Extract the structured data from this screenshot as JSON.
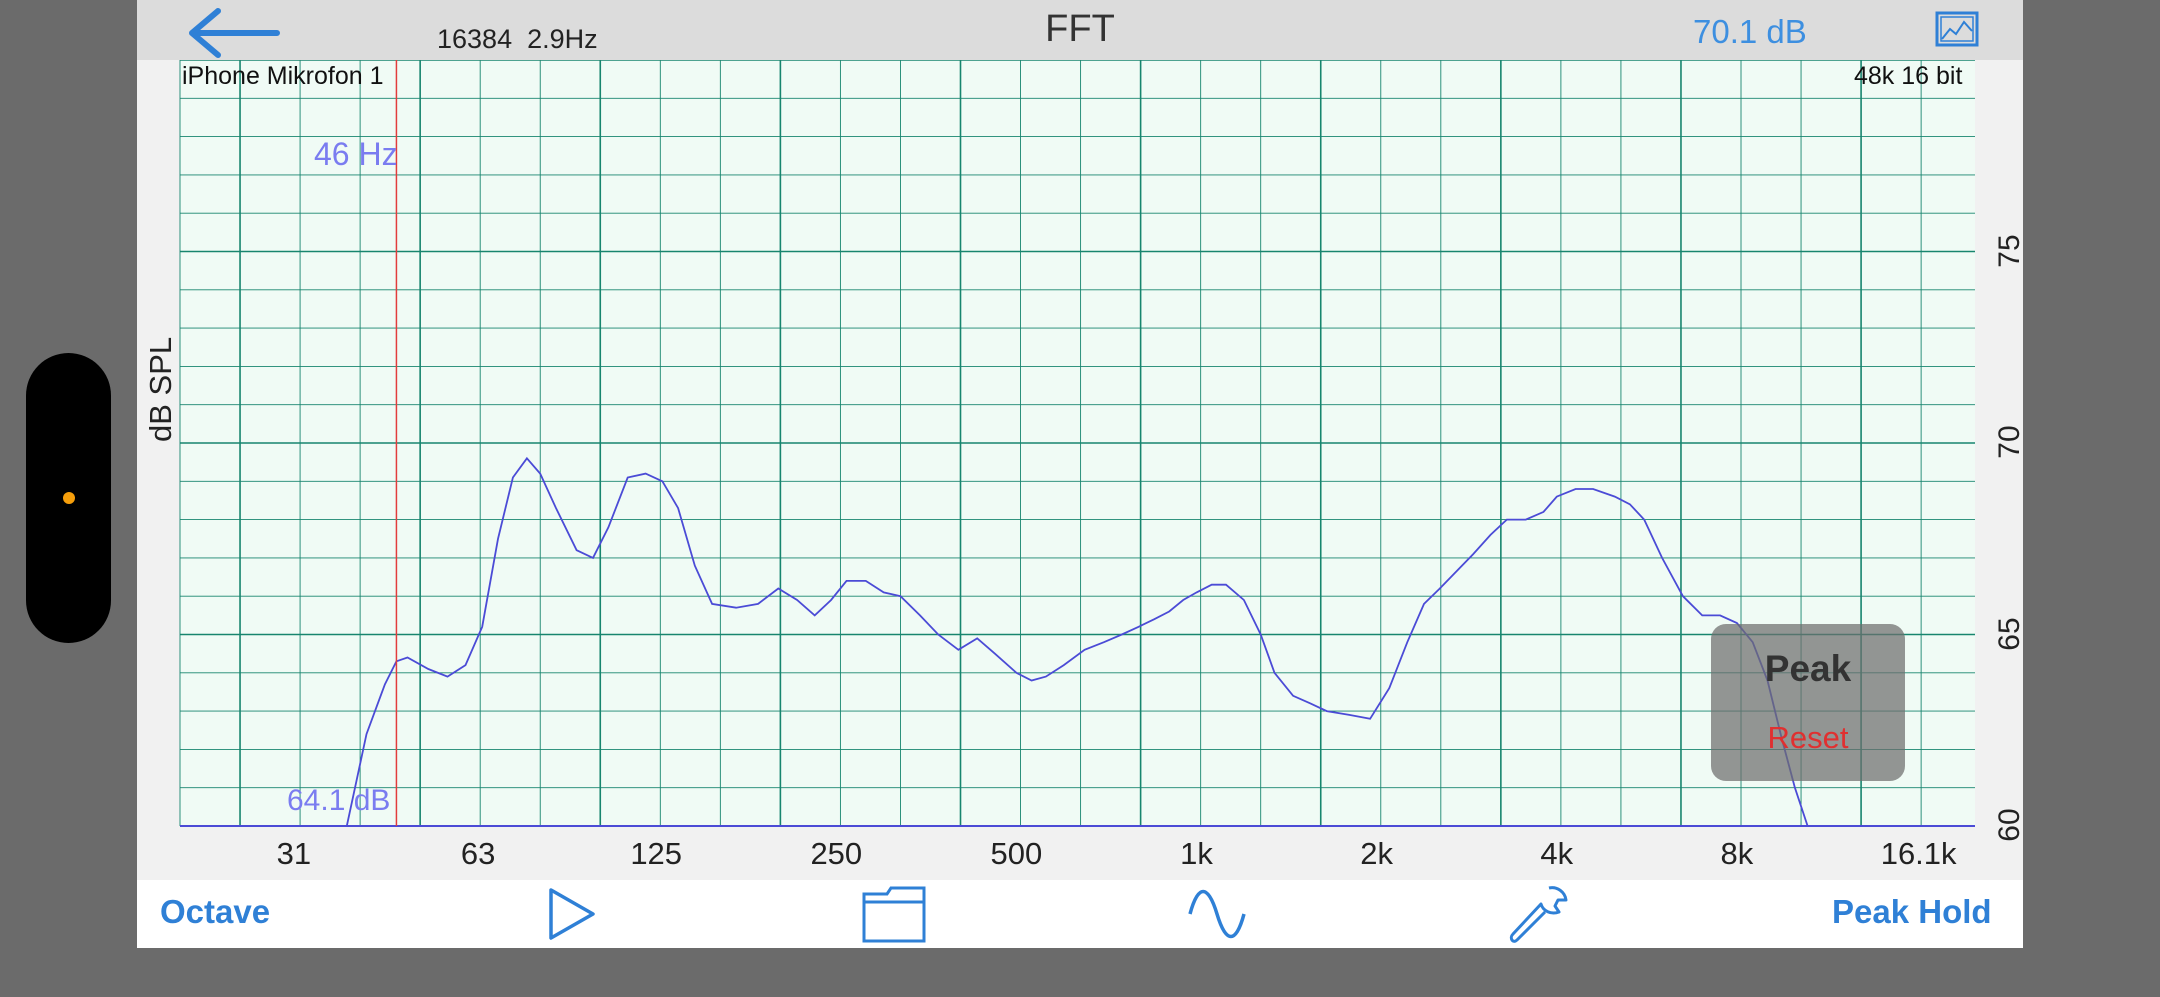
{
  "header": {
    "fft_size": "16384  2.9Hz",
    "title": "FFT",
    "level": "70.1 dB",
    "icons": {
      "back": "back-arrow-icon",
      "image": "image-icon"
    }
  },
  "plot": {
    "device_label": "iPhone Mikrofon 1",
    "format_label": "48k 16 bit",
    "y_axis_title": "dB SPL",
    "cursor_freq": "46 Hz",
    "cursor_db": "64.1 dB",
    "colors": {
      "grid": "#17856e",
      "trace": "#4b4bd6",
      "cursor": "#e23c3c",
      "background": "#f0fbf5"
    }
  },
  "peak_panel": {
    "peak_label": "Peak",
    "reset_label": "Reset"
  },
  "toolbar": {
    "octave_label": "Octave",
    "peak_hold_label": "Peak Hold",
    "icons": [
      "play-icon",
      "folder-icon",
      "sine-wave-icon",
      "wrench-icon"
    ],
    "accent": "#2f80d6"
  },
  "chart_data": {
    "type": "line",
    "xscale": "log",
    "x_tick_labels": [
      "31",
      "63",
      "125",
      "250",
      "500",
      "1k",
      "2k",
      "4k",
      "8k",
      "16.1k"
    ],
    "x_ticks": [
      31,
      63,
      125,
      250,
      500,
      1000,
      2000,
      4000,
      8000,
      16100
    ],
    "y_tick_labels": [
      "60",
      "65",
      "70",
      "75"
    ],
    "ylim": [
      60,
      80
    ],
    "xlim": [
      20,
      20000
    ],
    "series": [
      {
        "x": [
          38,
          41,
          44,
          46,
          48,
          52,
          56,
          60,
          64,
          68,
          72,
          76,
          80,
          85,
          92,
          98,
          104,
          112,
          120,
          128,
          136,
          145,
          155,
          170,
          185,
          200,
          215,
          230,
          245,
          260,
          280,
          300,
          320,
          345,
          370,
          400,
          430,
          460,
          500,
          530,
          560,
          600,
          650,
          700,
          750,
          800,
          850,
          900,
          950,
          1000,
          1060,
          1120,
          1200,
          1280,
          1350,
          1450,
          1550,
          1650,
          1800,
          1950,
          2100,
          2250,
          2400,
          2550,
          2700,
          2900,
          3100,
          3300,
          3550,
          3800,
          4000,
          4300,
          4600,
          5000,
          5300,
          5600,
          6000,
          6500,
          7000,
          7500,
          8000,
          8500,
          9000,
          9500,
          10000,
          10500
        ],
        "y": [
          60,
          62.4,
          63.7,
          64.3,
          64.4,
          64.1,
          63.9,
          64.2,
          65.2,
          67.5,
          69.1,
          69.6,
          69.2,
          68.3,
          67.2,
          67.0,
          67.8,
          69.1,
          69.2,
          69.0,
          68.3,
          66.8,
          65.8,
          65.7,
          65.8,
          66.2,
          65.9,
          65.5,
          65.9,
          66.4,
          66.4,
          66.1,
          66.0,
          65.5,
          65.0,
          64.6,
          64.9,
          64.5,
          64.0,
          63.8,
          63.9,
          64.2,
          64.6,
          64.8,
          65.0,
          65.2,
          65.4,
          65.6,
          65.9,
          66.1,
          66.3,
          66.3,
          65.9,
          65.0,
          64.0,
          63.4,
          63.2,
          63.0,
          62.9,
          62.8,
          63.6,
          64.8,
          65.8,
          66.2,
          66.6,
          67.1,
          67.6,
          68.0,
          68.0,
          68.2,
          68.6,
          68.8,
          68.8,
          68.6,
          68.4,
          68.0,
          67.0,
          66.0,
          65.5,
          65.5,
          65.3,
          64.8,
          63.8,
          62.3,
          61.0,
          60
        ]
      }
    ]
  }
}
